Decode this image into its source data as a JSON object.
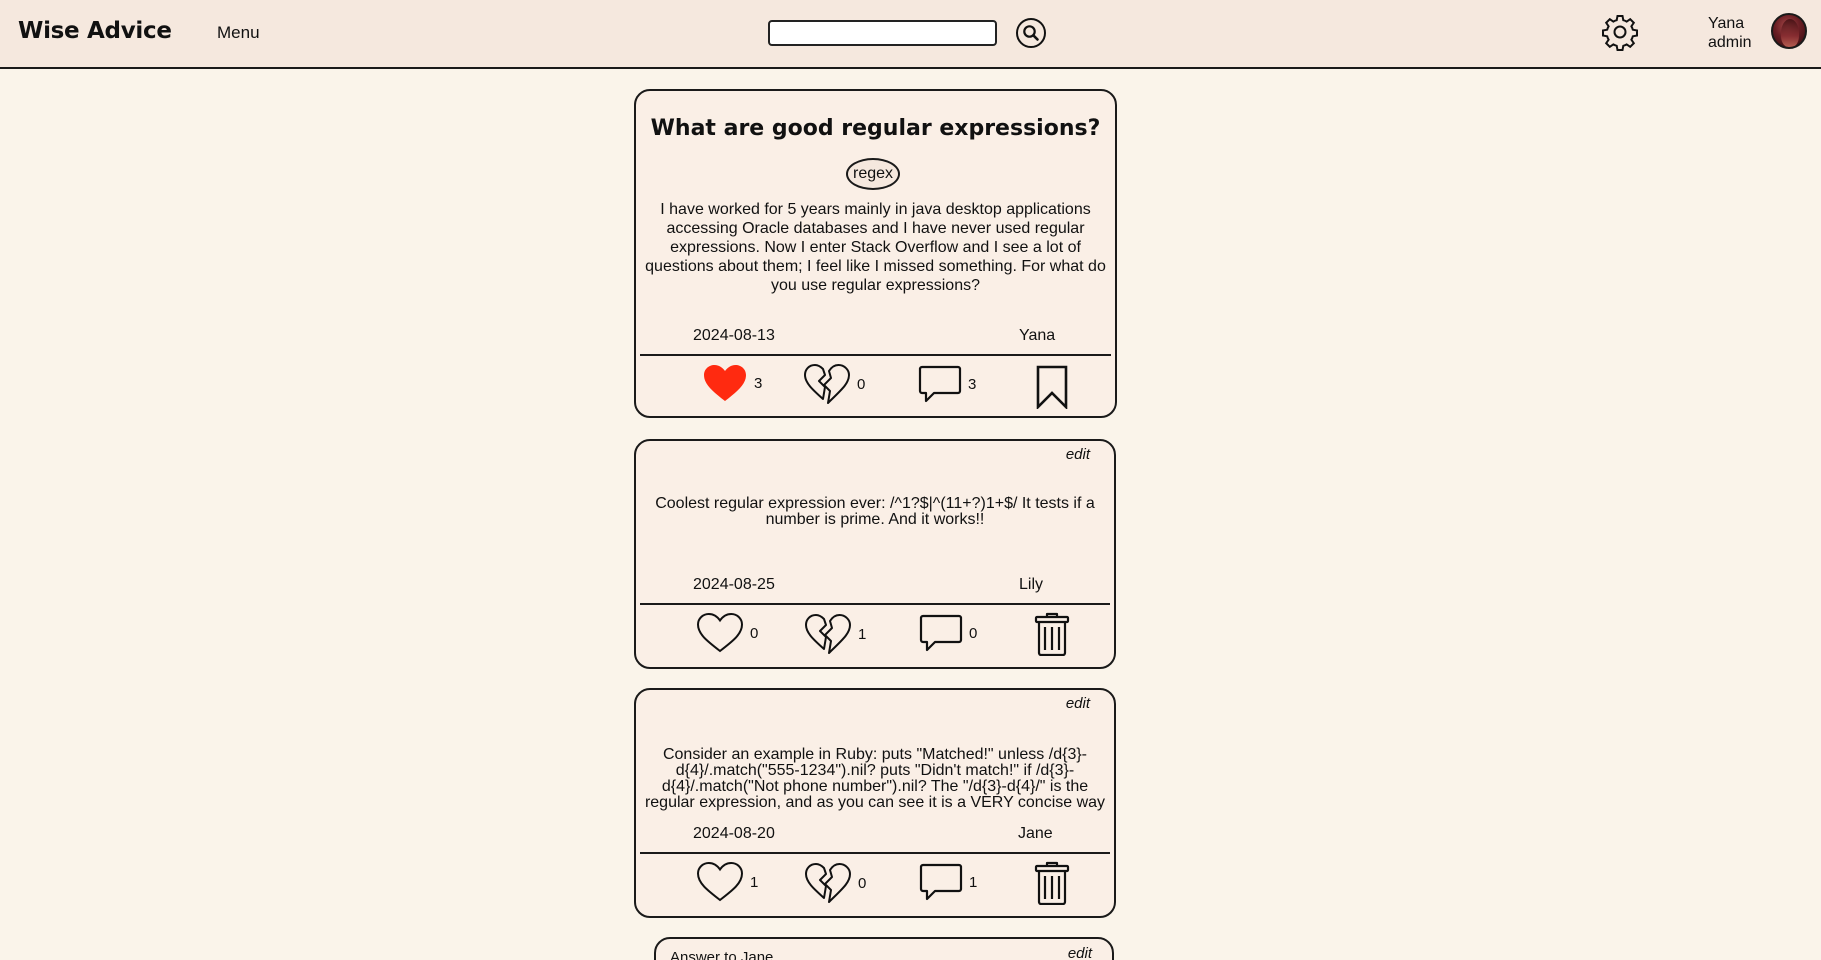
{
  "app": {
    "title": "Wise Advice",
    "menu_label": "Menu"
  },
  "search": {
    "placeholder": "",
    "value": ""
  },
  "user": {
    "name": "Yana",
    "role": "admin"
  },
  "question": {
    "title": "What are good regular expressions?",
    "tag": "regex",
    "body": "I have worked for 5 years mainly in java desktop applications accessing Oracle databases and I have never used regular expressions. Now I enter Stack Overflow and I see a lot of questions about them; I feel like I missed something. For what do you use regular expressions?",
    "date": "2024-08-13",
    "author": "Yana",
    "likes": "3",
    "dislikes": "0",
    "comments": "3",
    "liked": true
  },
  "answers": [
    {
      "edit_label": "edit",
      "body": "Coolest regular expression ever: /^1?$|^(11+?)1+$/ It tests if a number is prime. And it works!!",
      "date": "2024-08-25",
      "author": "Lily",
      "likes": "0",
      "dislikes": "1",
      "comments": "0"
    },
    {
      "edit_label": "edit",
      "body": "Consider an example in Ruby: puts \"Matched!\" unless /d{3}-d{4}/.match(\"555-1234\").nil? puts \"Didn't match!\" if /d{3}-d{4}/.match(\"Not phone number\").nil? The \"/d{3}-d{4}/\" is the regular expression, and as you can see it is a VERY concise way of",
      "date": "2024-08-20",
      "author": "Jane",
      "likes": "1",
      "dislikes": "0",
      "comments": "1"
    },
    {
      "edit_label": "edit",
      "title": "Answer to Jane"
    }
  ],
  "icons": {
    "search": "search-icon",
    "settings": "gear-icon",
    "like": "heart-icon",
    "dislike": "broken-heart-icon",
    "comment": "speech-bubble-icon",
    "bookmark": "bookmark-icon",
    "delete": "trash-icon"
  },
  "colors": {
    "heart_filled": "#ff2a10",
    "page_bg": "#faf4ea",
    "header_bg": "#f5e8de"
  }
}
